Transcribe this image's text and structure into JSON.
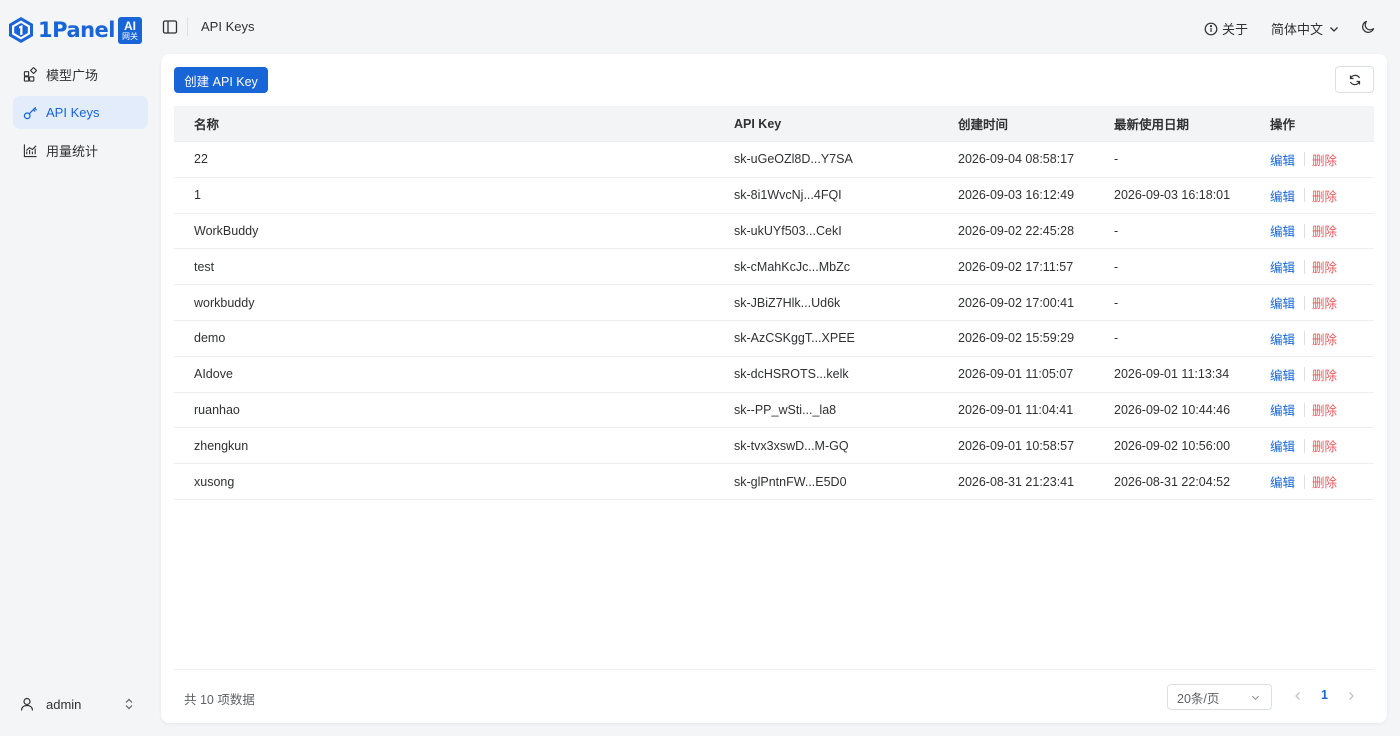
{
  "brand": {
    "name": "1Panel",
    "badge_line1": "AI",
    "badge_line2": "网关",
    "color": "#1865d8"
  },
  "sidebar": {
    "items": [
      {
        "label": "模型广场",
        "icon": "grid-icon",
        "active": false
      },
      {
        "label": "API Keys",
        "icon": "key-icon",
        "active": true
      },
      {
        "label": "用量统计",
        "icon": "chart-icon",
        "active": false
      }
    ],
    "user": {
      "name": "admin",
      "icon": "user-icon"
    }
  },
  "header": {
    "title": "API Keys",
    "about_label": "关于",
    "language_label": "简体中文"
  },
  "toolbar": {
    "create_label": "创建 API Key"
  },
  "table": {
    "columns": [
      "名称",
      "API Key",
      "创建时间",
      "最新使用日期",
      "操作"
    ],
    "edit_label": "编辑",
    "delete_label": "删除",
    "rows": [
      {
        "name": "22",
        "key": "sk-uGeOZl8D...Y7SA",
        "created": "2026-09-04 08:58:17",
        "last_used": "-"
      },
      {
        "name": "1",
        "key": "sk-8i1WvcNj...4FQI",
        "created": "2026-09-03 16:12:49",
        "last_used": "2026-09-03 16:18:01"
      },
      {
        "name": "WorkBuddy",
        "key": "sk-ukUYf503...CekI",
        "created": "2026-09-02 22:45:28",
        "last_used": "-"
      },
      {
        "name": "test",
        "key": "sk-cMahKcJc...MbZc",
        "created": "2026-09-02 17:11:57",
        "last_used": "-"
      },
      {
        "name": "workbuddy",
        "key": "sk-JBiZ7Hlk...Ud6k",
        "created": "2026-09-02 17:00:41",
        "last_used": "-"
      },
      {
        "name": "demo",
        "key": "sk-AzCSKggT...XPEE",
        "created": "2026-09-02 15:59:29",
        "last_used": "-"
      },
      {
        "name": "AIdove",
        "key": "sk-dcHSROTS...kelk",
        "created": "2026-09-01 11:05:07",
        "last_used": "2026-09-01 11:13:34"
      },
      {
        "name": "ruanhao",
        "key": "sk--PP_wSti..._la8",
        "created": "2026-09-01 11:04:41",
        "last_used": "2026-09-02 10:44:46"
      },
      {
        "name": "zhengkun",
        "key": "sk-tvx3xswD...M-GQ",
        "created": "2026-09-01 10:58:57",
        "last_used": "2026-09-02 10:56:00"
      },
      {
        "name": "xusong",
        "key": "sk-glPntnFW...E5D0",
        "created": "2026-08-31 21:23:41",
        "last_used": "2026-08-31 22:04:52"
      }
    ]
  },
  "pagination": {
    "total_text": "共 10 项数据",
    "page_size": "20条/页",
    "current_page": "1"
  }
}
